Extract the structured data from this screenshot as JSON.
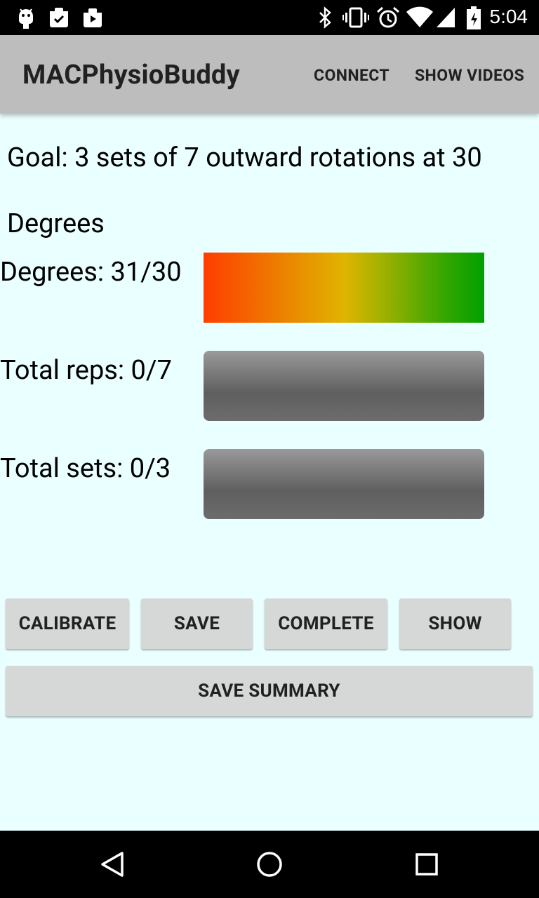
{
  "status_bar": {
    "time": "5:04",
    "left_icons": [
      "android-debug-icon",
      "clipboard-check-icon",
      "video-upload-icon"
    ],
    "right_icons": [
      "bluetooth-icon",
      "vibrate-icon",
      "alarm-icon",
      "wifi-icon",
      "signal-icon",
      "battery-icon"
    ]
  },
  "app_bar": {
    "title": "MACPhysioBuddy",
    "actions": [
      "CONNECT",
      "SHOW VIDEOS"
    ]
  },
  "goal_text": "Goal: 3 sets of 7 outward rotations at 30 Degrees",
  "metrics": {
    "degrees": {
      "label": "Degrees: 31/30",
      "current": 31,
      "target": 30
    },
    "reps": {
      "label": "Total reps: 0/7",
      "current": 0,
      "target": 7
    },
    "sets": {
      "label": "Total sets: 0/3",
      "current": 0,
      "target": 3
    }
  },
  "buttons": {
    "calibrate": "CALIBRATE",
    "save": "SAVE",
    "complete": "COMPLETE",
    "show": "SHOW",
    "save_summary": "SAVE SUMMARY"
  },
  "colors": {
    "background": "#EAFFFF",
    "app_bar": "#BDBDBD",
    "button": "#D6D7D7",
    "gradient_start": "#FF3D00",
    "gradient_mid": "#E0B400",
    "gradient_end": "#00A000",
    "bar_gray": "#666666"
  },
  "nav_bar": {
    "icons": [
      "back-icon",
      "home-icon",
      "recents-icon"
    ]
  }
}
